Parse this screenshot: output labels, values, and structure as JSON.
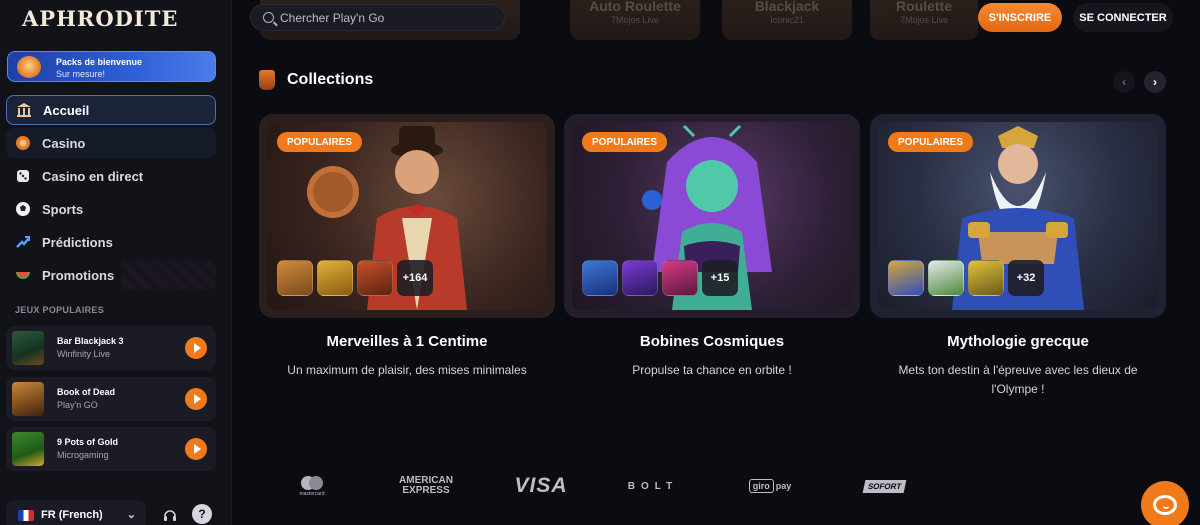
{
  "brand": {
    "logo_text": "APHRODITE",
    "accent": "#f07a1a"
  },
  "sidebar": {
    "promo": {
      "title": "Packs de bienvenue",
      "subtitle": "Sur mesure!"
    },
    "nav": [
      {
        "label": "Accueil",
        "icon": "temple-icon",
        "active": true
      },
      {
        "label": "Casino",
        "icon": "chip-icon"
      },
      {
        "label": "Casino en direct",
        "icon": "dice-icon"
      },
      {
        "label": "Sports",
        "icon": "soccer-ball-icon"
      },
      {
        "label": "Prédictions",
        "icon": "trend-arrow-icon"
      },
      {
        "label": "Promotions",
        "icon": "watermelon-icon"
      }
    ],
    "popular_heading": "JEUX POPULAIRES",
    "popular_games": [
      {
        "title": "Bar Blackjack 3",
        "provider": "Winfinity Live"
      },
      {
        "title": "Book of Dead",
        "provider": "Play'n GO"
      },
      {
        "title": "9 Pots of Gold",
        "provider": "Microgaming"
      }
    ],
    "language": "FR (French)"
  },
  "header": {
    "search_placeholder": "Chercher Play'n Go",
    "signup_label": "S'INSCRIRE",
    "login_label": "SE CONNECTER",
    "background_tiles": [
      {
        "title": "Auto Roulette",
        "provider": "7Mojos Live"
      },
      {
        "title": "Blackjack",
        "provider": "Iconic21"
      },
      {
        "title": "Roulette",
        "provider": "7Mojos Live"
      }
    ]
  },
  "collections": {
    "title": "Collections",
    "items": [
      {
        "badge": "POPULAIRES",
        "more": "+164",
        "name": "Merveilles à 1 Centime",
        "description": "Un maximum de plaisir, des mises minimales"
      },
      {
        "badge": "POPULAIRES",
        "more": "+15",
        "name": "Bobines Cosmiques",
        "description": "Propulse ta chance en orbite !"
      },
      {
        "badge": "POPULAIRES",
        "more": "+32",
        "name": "Mythologie grecque",
        "description": "Mets ton destin à l'épreuve avec les dieux de l'Olympe !"
      }
    ]
  },
  "payments": {
    "mastercard": "mastercard",
    "amex_top": "AMERICAN",
    "amex_bottom": "EXPRESS",
    "visa": "VISA",
    "bolt": "BOLT",
    "giro": "giro",
    "giro_pay": "pay",
    "sofort": "SOFORT"
  }
}
